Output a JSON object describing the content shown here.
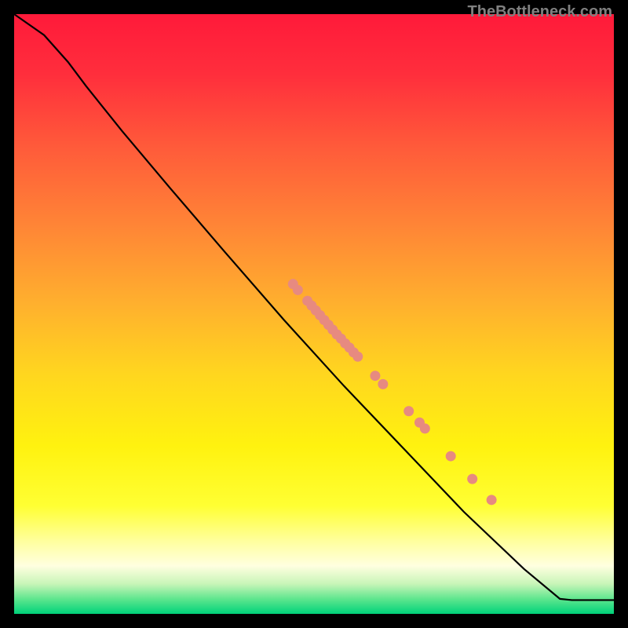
{
  "watermark": "TheBottleneck.com",
  "chart_data": {
    "type": "line",
    "title": "",
    "xlabel": "",
    "ylabel": "",
    "xlim": [
      0,
      100
    ],
    "ylim": [
      0,
      100
    ],
    "grid": false,
    "legend": false,
    "background_gradient": {
      "stops": [
        {
          "pos": 0.0,
          "color": "#ff1a3a"
        },
        {
          "pos": 0.1,
          "color": "#ff2e3c"
        },
        {
          "pos": 0.22,
          "color": "#ff5a3a"
        },
        {
          "pos": 0.35,
          "color": "#ff8436"
        },
        {
          "pos": 0.48,
          "color": "#ffaf2e"
        },
        {
          "pos": 0.6,
          "color": "#ffd61f"
        },
        {
          "pos": 0.72,
          "color": "#fff20f"
        },
        {
          "pos": 0.82,
          "color": "#ffff33"
        },
        {
          "pos": 0.88,
          "color": "#ffffa0"
        },
        {
          "pos": 0.92,
          "color": "#ffffe0"
        },
        {
          "pos": 0.95,
          "color": "#c8f5b8"
        },
        {
          "pos": 0.975,
          "color": "#5fe68e"
        },
        {
          "pos": 1.0,
          "color": "#00d27a"
        }
      ]
    },
    "curve": [
      {
        "x": 0.0,
        "y": 100.0
      },
      {
        "x": 5.0,
        "y": 96.5
      },
      {
        "x": 9.0,
        "y": 92.0
      },
      {
        "x": 12.0,
        "y": 88.0
      },
      {
        "x": 18.0,
        "y": 80.5
      },
      {
        "x": 26.0,
        "y": 71.0
      },
      {
        "x": 35.0,
        "y": 60.5
      },
      {
        "x": 45.0,
        "y": 49.0
      },
      {
        "x": 55.0,
        "y": 38.0
      },
      {
        "x": 65.0,
        "y": 27.5
      },
      {
        "x": 75.0,
        "y": 17.0
      },
      {
        "x": 85.0,
        "y": 7.5
      },
      {
        "x": 91.0,
        "y": 2.5
      },
      {
        "x": 93.0,
        "y": 2.3
      },
      {
        "x": 100.0,
        "y": 2.3
      }
    ],
    "points": [
      {
        "x": 46.5,
        "y": 55.0
      },
      {
        "x": 47.3,
        "y": 54.0
      },
      {
        "x": 48.9,
        "y": 52.2
      },
      {
        "x": 49.6,
        "y": 51.4
      },
      {
        "x": 50.3,
        "y": 50.6
      },
      {
        "x": 51.0,
        "y": 49.8
      },
      {
        "x": 51.7,
        "y": 49.0
      },
      {
        "x": 52.4,
        "y": 48.2
      },
      {
        "x": 53.1,
        "y": 47.4
      },
      {
        "x": 53.8,
        "y": 46.6
      },
      {
        "x": 54.5,
        "y": 45.9
      },
      {
        "x": 55.2,
        "y": 45.1
      },
      {
        "x": 55.9,
        "y": 44.4
      },
      {
        "x": 56.6,
        "y": 43.6
      },
      {
        "x": 57.3,
        "y": 42.9
      },
      {
        "x": 60.2,
        "y": 39.7
      },
      {
        "x": 61.5,
        "y": 38.3
      },
      {
        "x": 65.8,
        "y": 33.8
      },
      {
        "x": 67.6,
        "y": 31.9
      },
      {
        "x": 68.5,
        "y": 30.9
      },
      {
        "x": 72.8,
        "y": 26.3
      },
      {
        "x": 76.4,
        "y": 22.5
      },
      {
        "x": 79.6,
        "y": 19.0
      }
    ],
    "point_color": "#e78a80",
    "curve_color": "#000000"
  }
}
